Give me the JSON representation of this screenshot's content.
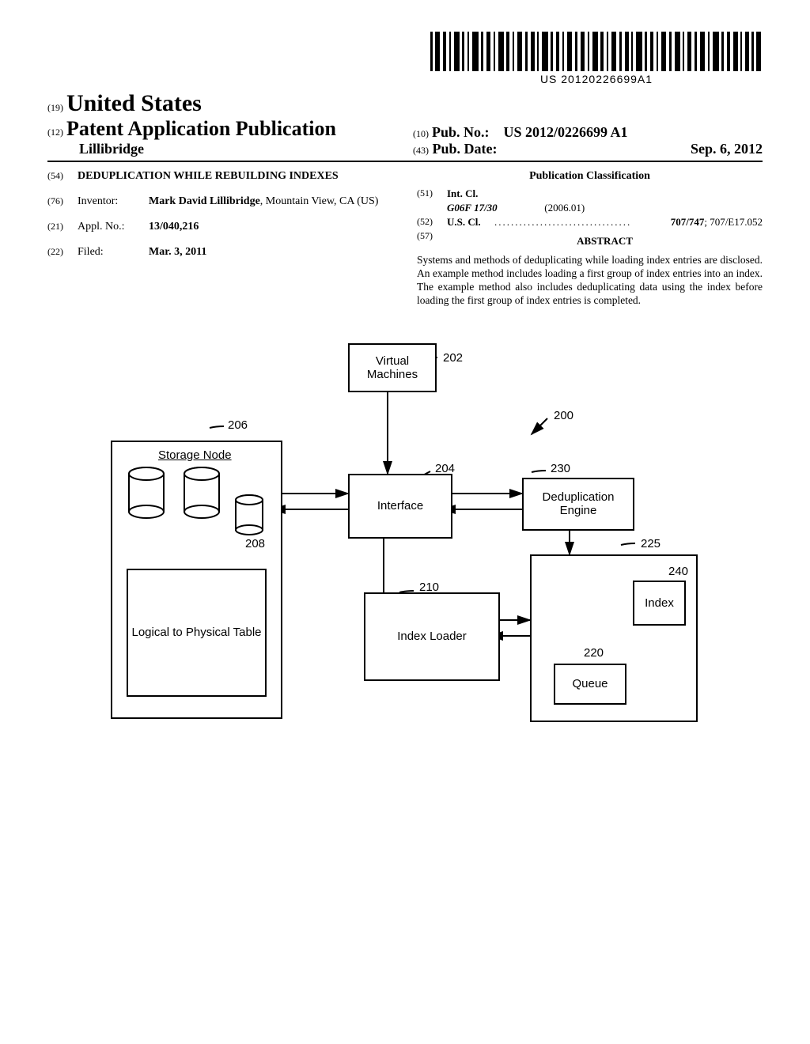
{
  "barcode": {
    "number": "US 20120226699A1"
  },
  "header": {
    "code_19": "(19)",
    "country": "United States",
    "code_12": "(12)",
    "pub_type": "Patent Application Publication",
    "author_surname": "Lillibridge",
    "code_10": "(10)",
    "pub_no_label": "Pub. No.:",
    "pub_no": "US 2012/0226699 A1",
    "code_43": "(43)",
    "pub_date_label": "Pub. Date:",
    "pub_date": "Sep. 6, 2012"
  },
  "left_col": {
    "title": {
      "code": "(54)",
      "text": "DEDUPLICATION WHILE REBUILDING INDEXES"
    },
    "inventor": {
      "code": "(76)",
      "label": "Inventor:",
      "name": "Mark David Lillibridge",
      "location": ", Mountain View, CA (US)"
    },
    "appl": {
      "code": "(21)",
      "label": "Appl. No.:",
      "value": "13/040,216"
    },
    "filed": {
      "code": "(22)",
      "label": "Filed:",
      "value": "Mar. 3, 2011"
    }
  },
  "right_col": {
    "classification_heading": "Publication Classification",
    "intcl": {
      "code": "(51)",
      "label": "Int. Cl.",
      "class": "G06F 17/30",
      "date": "(2006.01)"
    },
    "uscl": {
      "code": "(52)",
      "label": "U.S. Cl.",
      "dots": ".................................",
      "bold_value": "707/747",
      "rest": "; 707/E17.052"
    },
    "abstract": {
      "code": "(57)",
      "heading": "ABSTRACT",
      "text": "Systems and methods of deduplicating while loading index entries are disclosed. An example method includes loading a first group of index entries into an index. The example method also includes deduplicating data using the index before loading the first group of index entries is completed."
    }
  },
  "figure": {
    "virtual_machines": "Virtual Machines",
    "storage_node": "Storage Node",
    "logical_physical": "Logical to Physical Table",
    "interface": "Interface",
    "index_loader": "Index Loader",
    "dedup_engine": "Deduplication Engine",
    "index": "Index",
    "queue": "Queue",
    "ref_200": "200",
    "ref_202": "202",
    "ref_204": "204",
    "ref_206": "206",
    "ref_208": "208",
    "ref_210": "210",
    "ref_220": "220",
    "ref_225": "225",
    "ref_230": "230",
    "ref_240": "240"
  }
}
